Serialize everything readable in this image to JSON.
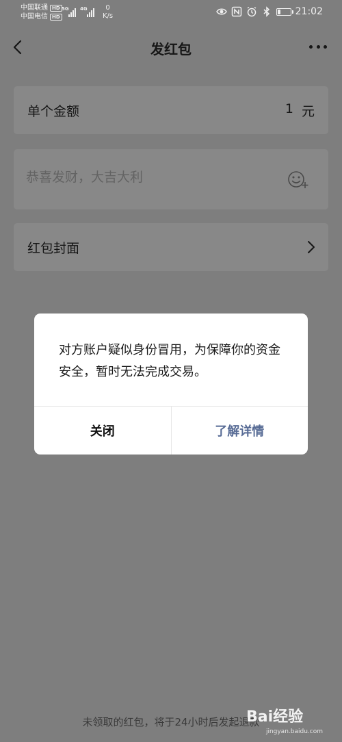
{
  "status_bar": {
    "carrier_1": "中国联通",
    "carrier_2": "中国电信",
    "hd_label": "HD",
    "network_1": "5G",
    "network_2": "4G",
    "speed_value": "0",
    "speed_unit": "K/s",
    "time": "21:02",
    "battery_level": 0.25,
    "icons": [
      "eye-icon",
      "nfc-icon",
      "alarm-icon",
      "bluetooth-icon",
      "battery-icon"
    ]
  },
  "nav": {
    "title": "发红包",
    "back_icon": "chevron-left-icon",
    "more_icon": "more-dots-icon"
  },
  "form": {
    "amount_label": "单个金额",
    "amount_value": "1",
    "amount_unit": "元",
    "greeting_placeholder": "恭喜发财，大吉大利",
    "greeting_value": "",
    "emoji_icon": "emoji-add-icon",
    "cover_label": "红包封面",
    "cover_icon": "chevron-right-icon"
  },
  "footer": {
    "tip": "未领取的红包，将于24小时后发起退款"
  },
  "dialog": {
    "message": "对方账户疑似身份冒用，为保障你的资金安全，暂时无法完成交易。",
    "close_label": "关闭",
    "details_label": "了解详情",
    "details_color": "#576b95"
  },
  "watermark": {
    "text": "Bai经验",
    "sub": "jingyan.baidu.com"
  },
  "colors": {
    "overlay_background": "#7e7e7e",
    "card_background": "#888888",
    "dialog_background": "#ffffff"
  }
}
